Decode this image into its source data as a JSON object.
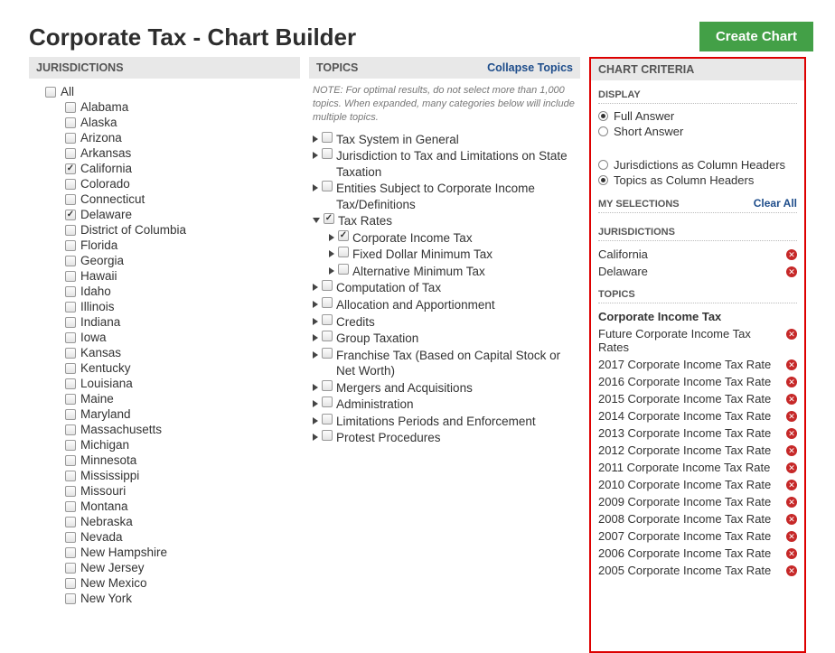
{
  "page_title": "Corporate Tax - Chart Builder",
  "create_button": "Create Chart",
  "jurisdictions": {
    "header": "JURISDICTIONS",
    "all_label": "All",
    "items": [
      {
        "label": "Alabama",
        "checked": false
      },
      {
        "label": "Alaska",
        "checked": false
      },
      {
        "label": "Arizona",
        "checked": false
      },
      {
        "label": "Arkansas",
        "checked": false
      },
      {
        "label": "California",
        "checked": true
      },
      {
        "label": "Colorado",
        "checked": false
      },
      {
        "label": "Connecticut",
        "checked": false
      },
      {
        "label": "Delaware",
        "checked": true
      },
      {
        "label": "District of Columbia",
        "checked": false
      },
      {
        "label": "Florida",
        "checked": false
      },
      {
        "label": "Georgia",
        "checked": false
      },
      {
        "label": "Hawaii",
        "checked": false
      },
      {
        "label": "Idaho",
        "checked": false
      },
      {
        "label": "Illinois",
        "checked": false
      },
      {
        "label": "Indiana",
        "checked": false
      },
      {
        "label": "Iowa",
        "checked": false
      },
      {
        "label": "Kansas",
        "checked": false
      },
      {
        "label": "Kentucky",
        "checked": false
      },
      {
        "label": "Louisiana",
        "checked": false
      },
      {
        "label": "Maine",
        "checked": false
      },
      {
        "label": "Maryland",
        "checked": false
      },
      {
        "label": "Massachusetts",
        "checked": false
      },
      {
        "label": "Michigan",
        "checked": false
      },
      {
        "label": "Minnesota",
        "checked": false
      },
      {
        "label": "Mississippi",
        "checked": false
      },
      {
        "label": "Missouri",
        "checked": false
      },
      {
        "label": "Montana",
        "checked": false
      },
      {
        "label": "Nebraska",
        "checked": false
      },
      {
        "label": "Nevada",
        "checked": false
      },
      {
        "label": "New Hampshire",
        "checked": false
      },
      {
        "label": "New Jersey",
        "checked": false
      },
      {
        "label": "New Mexico",
        "checked": false
      },
      {
        "label": "New York",
        "checked": false
      }
    ]
  },
  "topics": {
    "header": "TOPICS",
    "collapse": "Collapse Topics",
    "note": "NOTE: For optimal results, do not select more than 1,000 topics. When expanded, many categories below will include multiple topics.",
    "items": [
      {
        "label": "Tax System in General",
        "depth": 1,
        "checked": false,
        "open": false
      },
      {
        "label": "Jurisdiction to Tax and Limitations on State Taxation",
        "depth": 1,
        "checked": false,
        "open": false,
        "indent_continuation": true
      },
      {
        "label": "Entities Subject to Corporate Income Tax/Definitions",
        "depth": 1,
        "checked": false,
        "open": false,
        "indent_continuation": true
      },
      {
        "label": "Tax Rates",
        "depth": 1,
        "checked": true,
        "open": true
      },
      {
        "label": "Corporate Income Tax",
        "depth": 2,
        "checked": true,
        "open": false
      },
      {
        "label": "Fixed Dollar Minimum Tax",
        "depth": 2,
        "checked": false,
        "open": false
      },
      {
        "label": "Alternative Minimum Tax",
        "depth": 2,
        "checked": false,
        "open": false
      },
      {
        "label": "Computation of Tax",
        "depth": 1,
        "checked": false,
        "open": false
      },
      {
        "label": "Allocation and Apportionment",
        "depth": 1,
        "checked": false,
        "open": false
      },
      {
        "label": "Credits",
        "depth": 1,
        "checked": false,
        "open": false
      },
      {
        "label": "Group Taxation",
        "depth": 1,
        "checked": false,
        "open": false
      },
      {
        "label": "Franchise Tax (Based on Capital Stock or Net Worth)",
        "depth": 1,
        "checked": false,
        "open": false,
        "indent_continuation": true
      },
      {
        "label": "Mergers and Acquisitions",
        "depth": 1,
        "checked": false,
        "open": false
      },
      {
        "label": "Administration",
        "depth": 1,
        "checked": false,
        "open": false
      },
      {
        "label": "Limitations Periods and Enforcement",
        "depth": 1,
        "checked": false,
        "open": false
      },
      {
        "label": "Protest Procedures",
        "depth": 1,
        "checked": false,
        "open": false
      }
    ]
  },
  "criteria": {
    "header": "CHART CRITERIA",
    "display_heading": "DISPLAY",
    "answer_options": [
      {
        "label": "Full Answer",
        "selected": true
      },
      {
        "label": "Short Answer",
        "selected": false
      }
    ],
    "header_options": [
      {
        "label": "Jurisdictions as Column Headers",
        "selected": false
      },
      {
        "label": "Topics as Column Headers",
        "selected": true
      }
    ],
    "selections_heading": "MY SELECTIONS",
    "clear_all": "Clear All",
    "juris_heading": "JURISDICTIONS",
    "selected_jurisdictions": [
      "California",
      "Delaware"
    ],
    "topics_heading": "TOPICS",
    "selected_topic_group": "Corporate Income Tax",
    "selected_topics": [
      "Future Corporate Income Tax Rates",
      "2017 Corporate Income Tax Rate",
      "2016 Corporate Income Tax Rate",
      "2015 Corporate Income Tax Rate",
      "2014 Corporate Income Tax Rate",
      "2013 Corporate Income Tax Rate",
      "2012 Corporate Income Tax Rate",
      "2011 Corporate Income Tax Rate",
      "2010 Corporate Income Tax Rate",
      "2009 Corporate Income Tax Rate",
      "2008 Corporate Income Tax Rate",
      "2007 Corporate Income Tax Rate",
      "2006 Corporate Income Tax Rate",
      "2005 Corporate Income Tax Rate"
    ]
  }
}
